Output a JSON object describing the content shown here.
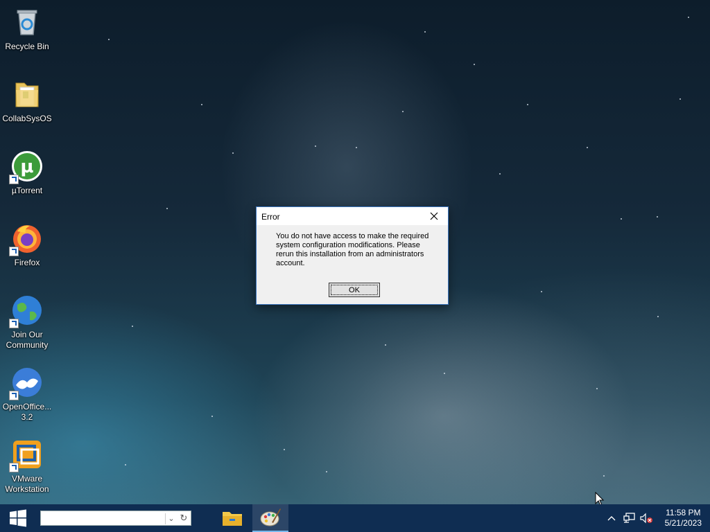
{
  "desktop": {
    "icons": [
      {
        "name": "recycle-bin",
        "label": "Recycle Bin"
      },
      {
        "name": "collabsysos-folder",
        "label": "CollabSysOS"
      },
      {
        "name": "utorrent",
        "label": "µTorrent"
      },
      {
        "name": "firefox",
        "label": "Firefox"
      },
      {
        "name": "join-our-community",
        "label": "Join Our Community"
      },
      {
        "name": "openoffice",
        "label": "OpenOffice... 3.2"
      },
      {
        "name": "vmware-workstation",
        "label": "VMware Workstation"
      }
    ]
  },
  "dialog": {
    "title": "Error",
    "message": "You do not have access to make the required system configuration modifications. Please rerun this installation from an administrators account.",
    "ok_label": "OK",
    "close_icon": "close-icon"
  },
  "taskbar": {
    "search_value": "",
    "pinned": [
      {
        "name": "file-explorer",
        "icon": "folder-icon",
        "active": false
      },
      {
        "name": "paint-app",
        "icon": "palette-icon",
        "active": true
      }
    ],
    "tray_icons": [
      "chevron-up-icon",
      "network-icon",
      "volume-muted-icon"
    ],
    "time": "11:58 PM",
    "date": "5/21/2023"
  },
  "colors": {
    "taskbar": "#0f2d52",
    "dialog_border": "#3b76c0",
    "dialog_bg": "#f0f0f0"
  }
}
